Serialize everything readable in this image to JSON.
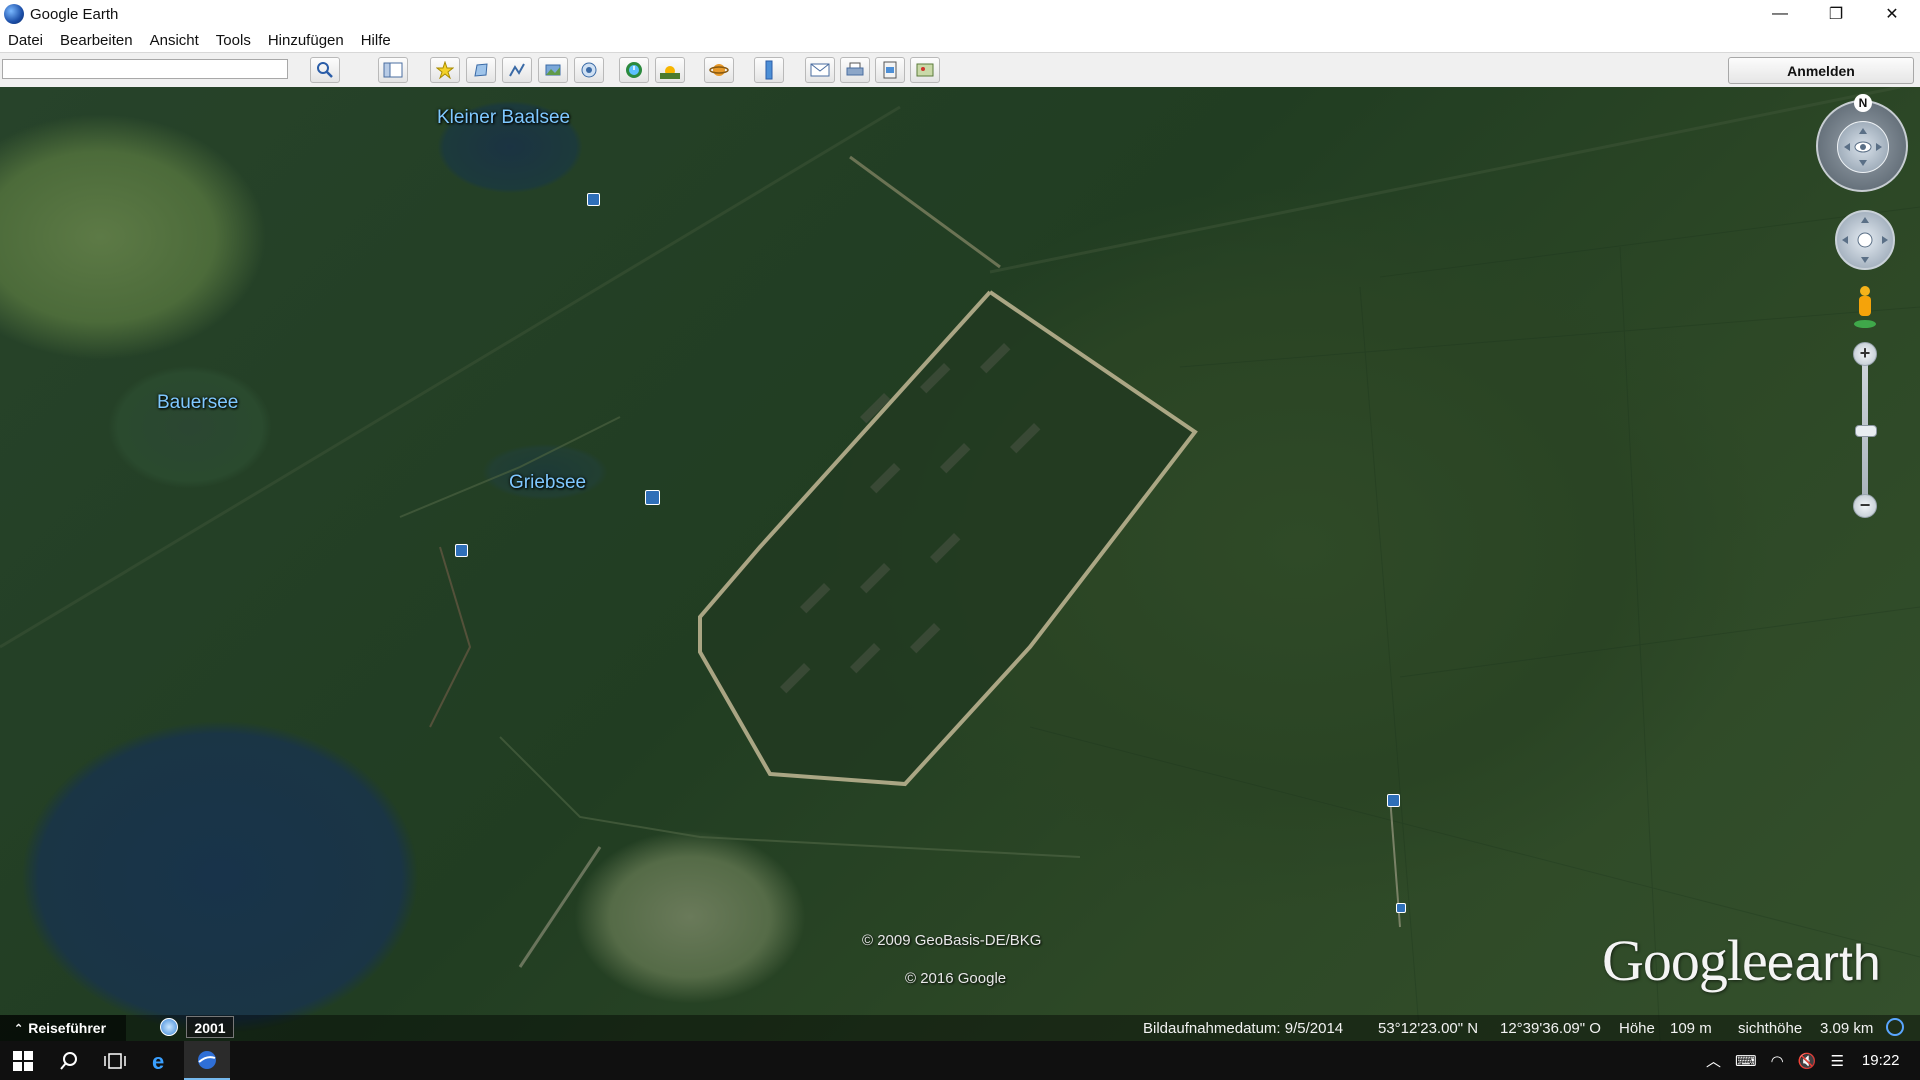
{
  "window": {
    "title": "Google Earth",
    "controls": {
      "minimize": "—",
      "restore": "❐",
      "close": "✕"
    }
  },
  "menu": [
    "Datei",
    "Bearbeiten",
    "Ansicht",
    "Tools",
    "Hinzufügen",
    "Hilfe"
  ],
  "toolbar": {
    "search_value": "",
    "buttons": [
      "search-icon",
      "sidebar-icon",
      "placemark-icon",
      "polygon-icon",
      "path-icon",
      "overlay-icon",
      "tour-icon",
      "historical-imagery-icon",
      "sun-icon",
      "planet-icon",
      "ruler-icon",
      "email-icon",
      "print-icon",
      "save-image-icon",
      "maps-icon"
    ],
    "signin_label": "Anmelden"
  },
  "map": {
    "places": [
      {
        "name": "Kleiner Baalsee"
      },
      {
        "name": "Bauersee"
      },
      {
        "name": "Griebsee"
      }
    ],
    "copyright_1": "© 2009 GeoBasis-DE/BKG",
    "copyright_2": "© 2016 Google",
    "logo_g": "Google",
    "logo_e": "earth",
    "north_label": "N",
    "zoom_in": "+",
    "zoom_out": "−"
  },
  "status": {
    "guide_label": "Reiseführer",
    "year": "2001",
    "image_date": "Bildaufnahmedatum: 9/5/2014",
    "lat": "53°12'23.00\" N",
    "lon": "12°39'36.09\" O",
    "elevation_label": "Höhe",
    "elevation": "109 m",
    "eye_alt_label": "sichthöhe",
    "eye_alt": "3.09 km"
  },
  "taskbar": {
    "time": "19:22",
    "icons": [
      "windows-start-icon",
      "search-icon",
      "task-view-icon",
      "edge-icon",
      "google-earth-icon"
    ]
  }
}
